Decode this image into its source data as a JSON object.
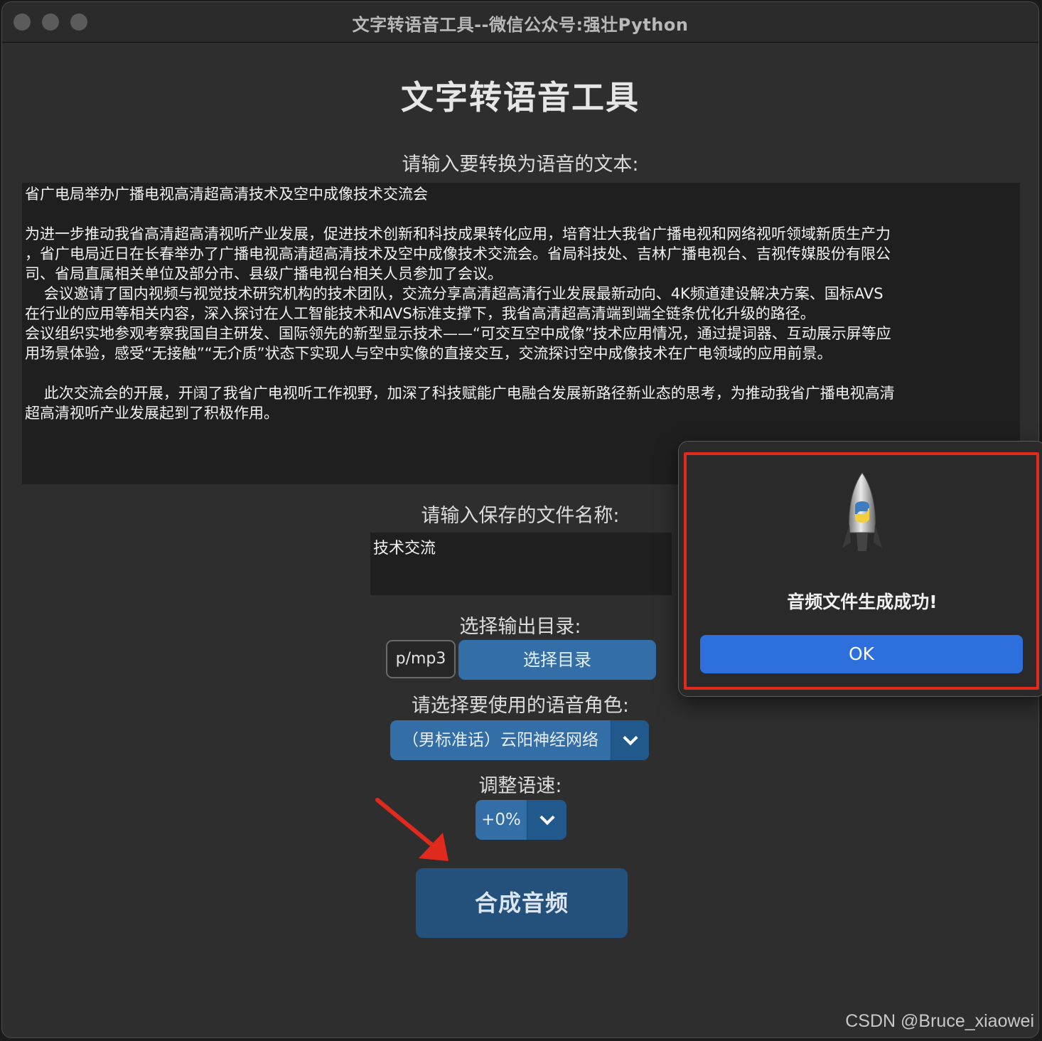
{
  "window": {
    "title": "文字转语音工具--微信公众号:强壮Python"
  },
  "app": {
    "heading": "文字转语音工具",
    "text_label": "请输入要转换为语音的文本:",
    "text_content": "省广电局举办广播电视高清超高清技术及空中成像技术交流会\n\n为进一步推动我省高清超高清视听产业发展，促进技术创新和科技成果转化应用，培育壮大我省广播电视和网络视听领域新质生产力\n，省广电局近日在长春举办了广播电视高清超高清技术及空中成像技术交流会。省局科技处、吉林广播电视台、吉视传媒股份有限公\n司、省局直属相关单位及部分市、县级广播电视台相关人员参加了会议。\n    会议邀请了国内视频与视觉技术研究机构的技术团队，交流分享高清超高清行业发展最新动向、4K频道建设解决方案、国标AVS\n在行业的应用等相关内容，深入探讨在人工智能技术和AVS标准支撑下，我省高清超高清端到端全链条优化升级的路径。\n会议组织实地参观考察我国自主研发、国际领先的新型显示技术——“可交互空中成像”技术应用情况，通过提词器、互动展示屏等应\n用场景体验，感受“无接触”“无介质”状态下实现人与空中实像的直接交互，交流探讨空中成像技术在广电领域的应用前景。\n\n    此次交流会的开展，开阔了我省广电视听工作视野，加深了科技赋能广电融合发展新路径新业态的思考，为推动我省广播电视高清\n超高清视听产业发展起到了积极作用。",
    "filename_label": "请输入保存的文件名称:",
    "filename_value": "技术交流",
    "dir_label": "选择输出目录:",
    "dir_value": "p/mp3",
    "dir_button": "选择目录",
    "voice_label": "请选择要使用的语音角色:",
    "voice_value": "（男标准话）云阳神经网络",
    "speed_label": "调整语速:",
    "speed_value": "+0%",
    "synth_button": "合成音频"
  },
  "dialog": {
    "icon": "python-launcher-rocket-icon",
    "message": "音频文件生成成功!",
    "ok_button": "OK"
  },
  "watermark": "CSDN @Bruce_xiaowei",
  "colors": {
    "window_bg": "#2e2e2e",
    "input_bg": "#1f1f1f",
    "button_blue": "#336ea6",
    "dark_blue": "#24507c",
    "dialog_ok": "#2d6fdc",
    "annotation_red": "#e02a1e"
  }
}
